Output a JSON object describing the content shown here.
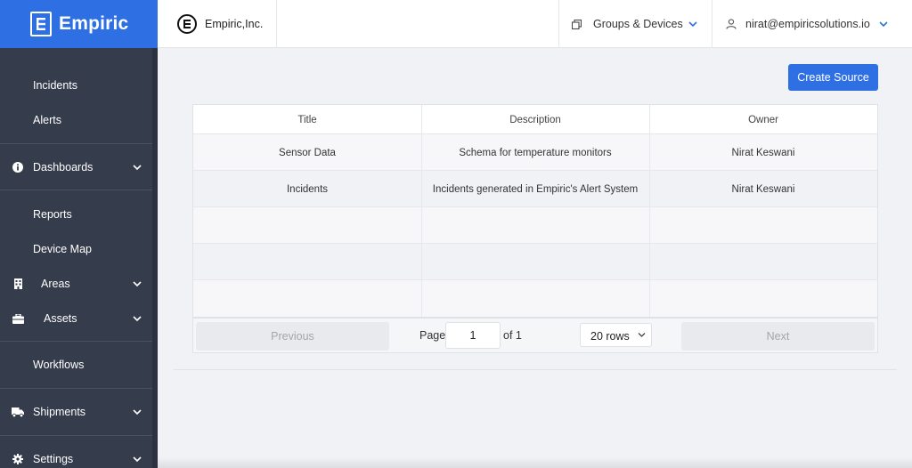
{
  "brand": {
    "name": "Empiric",
    "accent": "#2f6fe4"
  },
  "sidebar": {
    "items": [
      {
        "label": "Incidents",
        "icon": ""
      },
      {
        "label": "Alerts",
        "icon": ""
      },
      {
        "label": "Dashboards",
        "icon": "info-circle-icon"
      },
      {
        "label": "Reports",
        "icon": ""
      },
      {
        "label": "Device Map",
        "icon": ""
      },
      {
        "label": "Areas",
        "icon": "building-icon"
      },
      {
        "label": "Assets",
        "icon": "briefcase-icon"
      },
      {
        "label": "Workflows",
        "icon": ""
      },
      {
        "label": "Shipments",
        "icon": "truck-icon"
      },
      {
        "label": "Settings",
        "icon": "gear-icon"
      }
    ]
  },
  "header": {
    "org_name": "Empiric,Inc.",
    "groups_label": "Groups & Devices",
    "user_email": "nirat@empiricsolutions.io"
  },
  "toolbar": {
    "create_label": "Create Source"
  },
  "table": {
    "columns": [
      "Title",
      "Description",
      "Owner"
    ],
    "rows": [
      [
        "Sensor Data",
        "Schema for temperature monitors",
        "Nirat Keswani"
      ],
      [
        "Incidents",
        "Incidents generated in Empiric's Alert System",
        "Nirat Keswani"
      ]
    ]
  },
  "pagination": {
    "previous_label": "Previous",
    "page_label": "Page",
    "page_value": "1",
    "of_label": "of 1",
    "rows_label": "20 rows",
    "next_label": "Next"
  }
}
